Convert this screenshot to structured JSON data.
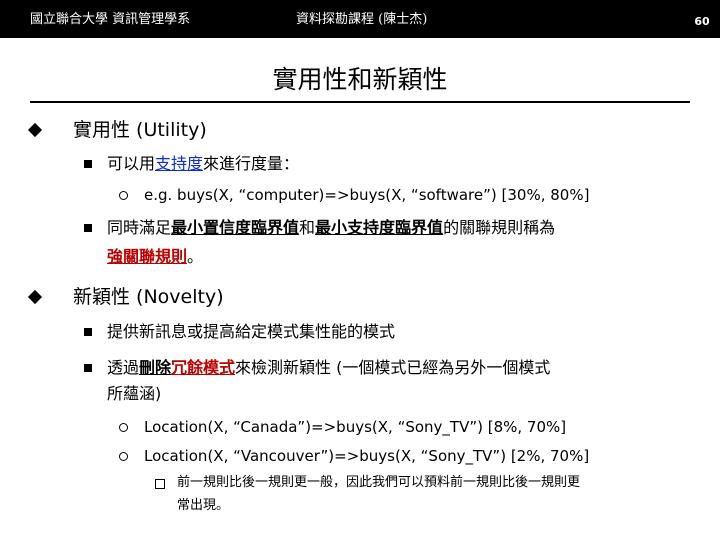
{
  "header": {
    "left": "國立聯合大學 資訊管理學系",
    "center": "資料探勘課程 (陳士杰)",
    "page_number": "60"
  },
  "title": "實用性和新穎性",
  "sections": {
    "utility": {
      "heading": "實用性 (Utility)",
      "item1": {
        "prefix": "可以用",
        "keyword": "支持度",
        "suffix": "來進行度量："
      },
      "example": "e.g. buys(X, “computer)=>buys(X, “software”) [30%, 80%]",
      "item2": {
        "prefix": "同時滿足",
        "kw1": "最小置信度臨界值",
        "mid": "和",
        "kw2": "最小支持度臨界值",
        "suffix": "的關聯規則稱為",
        "kw3": "強關聯規則",
        "end": "。"
      }
    },
    "novelty": {
      "heading": "新穎性 (Novelty)",
      "item1": "提供新訊息或提高給定模式集性能的模式",
      "item2": {
        "prefix": "透過",
        "kw1": "刪除",
        "kw2": "冗餘模式",
        "suffix": "來檢測新穎性 (一個模式已經為另外一個模式",
        "line2": "所蘊涵)"
      },
      "example1": "Location(X, “Canada”)=>buys(X, “Sony_TV”) [8%, 70%]",
      "example2": "Location(X, “Vancouver”)=>buys(X, “Sony_TV”) [2%, 70%]",
      "note_line1": "前一規則比後一規則更一般，因此我們可以預料前一規則比後一規則更",
      "note_line2": "常出現。"
    }
  }
}
